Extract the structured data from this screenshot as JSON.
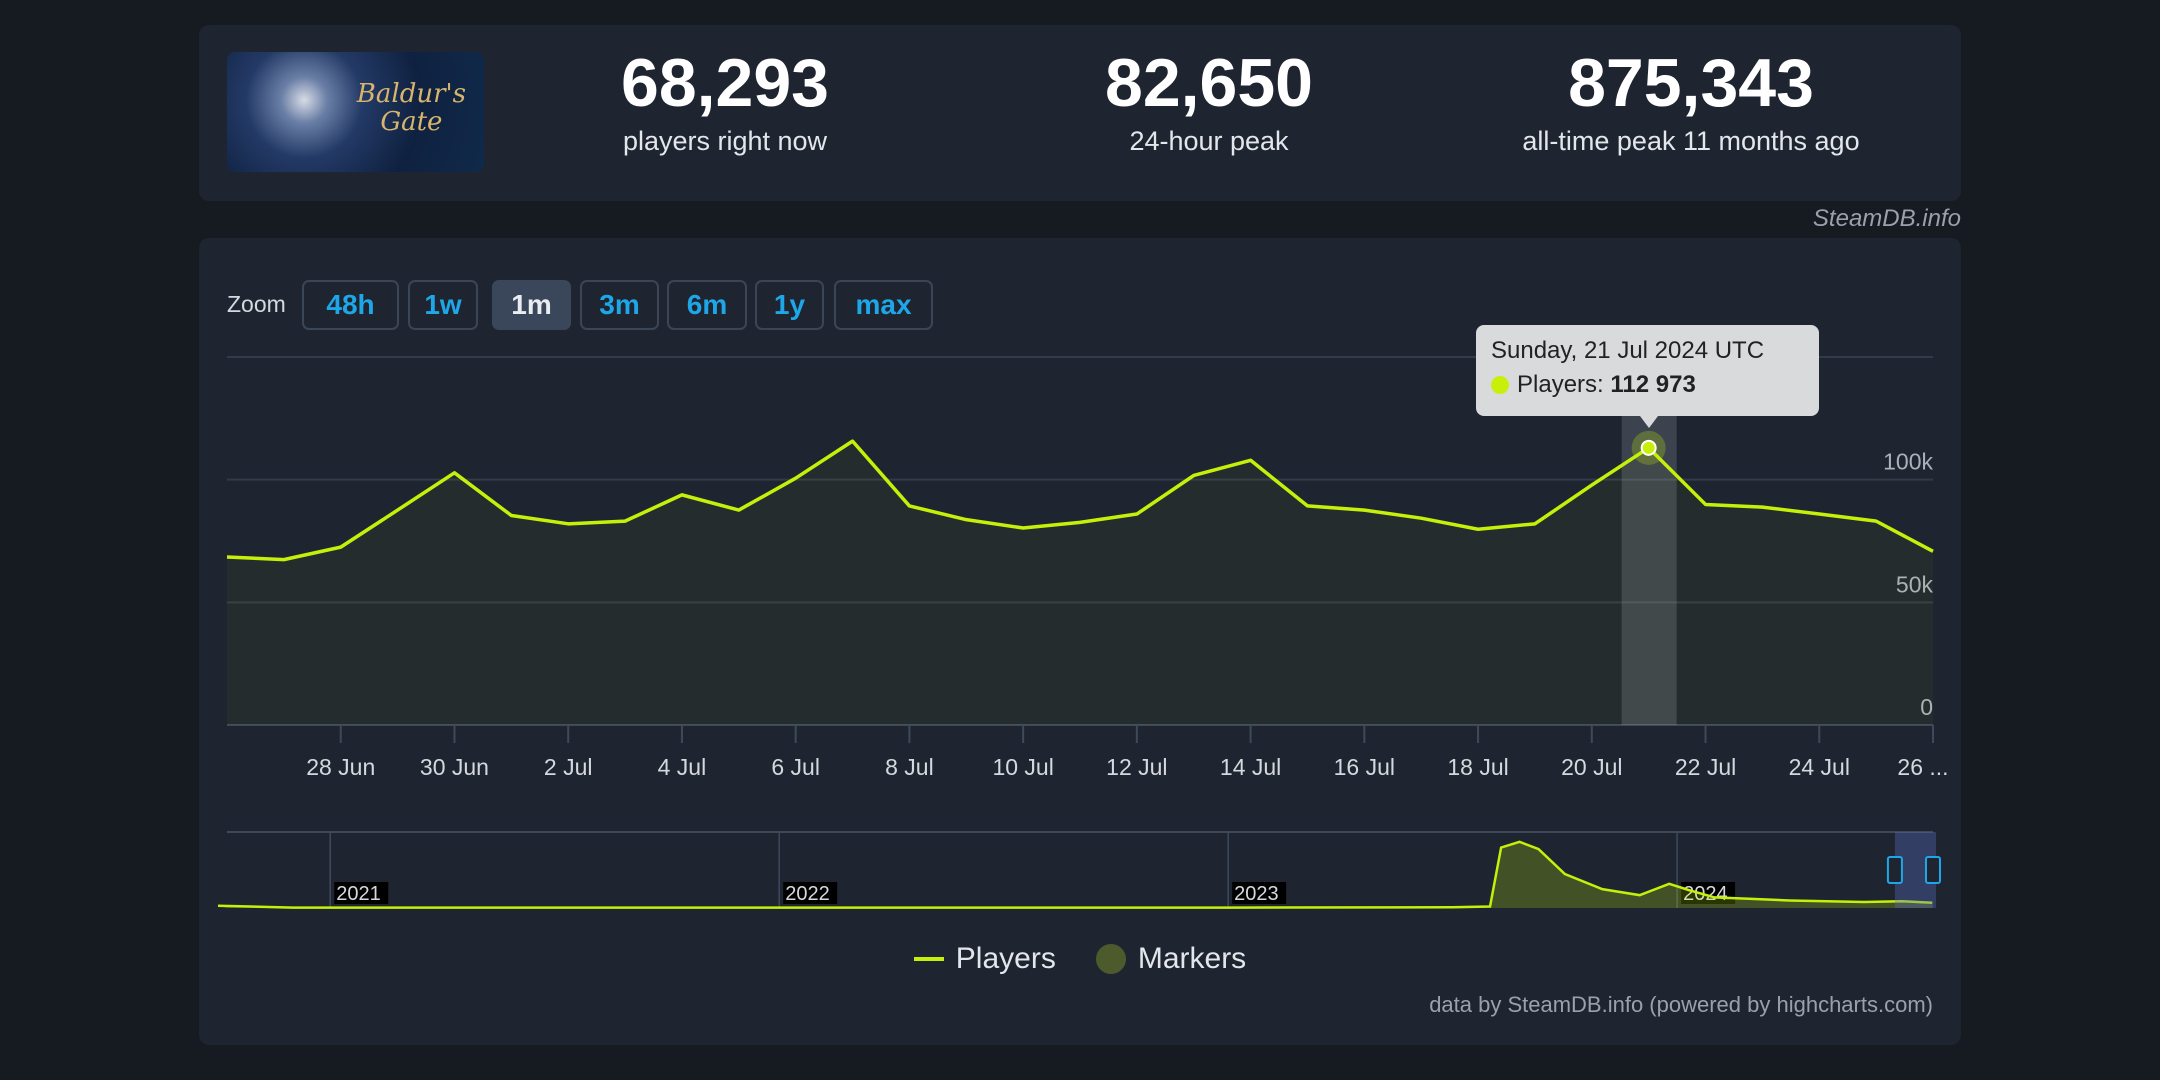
{
  "stats": {
    "image_caption": "Baldur's Gate",
    "current": {
      "value": "68,293",
      "label": "players right now"
    },
    "peak24": {
      "value": "82,650",
      "label": "24-hour peak"
    },
    "alltime": {
      "value": "875,343",
      "label": "all-time peak 11 months ago"
    }
  },
  "credit_top": "SteamDB.info",
  "zoom": {
    "label": "Zoom",
    "buttons": [
      "48h",
      "1w",
      "1m",
      "3m",
      "6m",
      "1y",
      "max"
    ],
    "active": "1m"
  },
  "tooltip": {
    "date": "Sunday, 21 Jul 2024 UTC",
    "series": "Players:",
    "value": "112 973"
  },
  "legend": {
    "players": "Players",
    "markers": "Markers"
  },
  "credit_bottom": "data by SteamDB.info (powered by highcharts.com)",
  "colors": {
    "line": "#c6f00a",
    "markers": "#4d5b2c",
    "accent": "#1ea7e8",
    "background": "#1f2530"
  },
  "chart_data": [
    {
      "type": "area",
      "series": [
        {
          "name": "Players",
          "start": "2024-06-26",
          "interval": "1 day",
          "values": [
            68500,
            67400,
            72500,
            87600,
            102800,
            85400,
            82000,
            83100,
            93800,
            87600,
            100600,
            115700,
            89300,
            83700,
            80300,
            82600,
            86000,
            101700,
            107900,
            89300,
            87600,
            84300,
            79800,
            82000,
            97800,
            112973,
            89900,
            88800,
            86000,
            83100,
            70800
          ]
        }
      ],
      "x_tick_labels": [
        "28 Jun",
        "30 Jun",
        "2 Jul",
        "4 Jul",
        "6 Jul",
        "8 Jul",
        "10 Jul",
        "12 Jul",
        "14 Jul",
        "16 Jul",
        "18 Jul",
        "20 Jul",
        "22 Jul",
        "24 Jul",
        "26 ..."
      ],
      "y_tick_labels": [
        "0",
        "50k",
        "100k"
      ],
      "ylim": [
        0,
        150000
      ],
      "grid": true,
      "highlighted_point": "2024-07-21",
      "legend": "bottom"
    },
    {
      "type": "area",
      "role": "navigator",
      "x_tick_labels": [
        "2021",
        "2022",
        "2023",
        "2024"
      ],
      "series": [
        {
          "name": "Players",
          "points": [
            [
              "2020-10",
              30000
            ],
            [
              "2020-12",
              5000
            ],
            [
              "2021-06",
              5000
            ],
            [
              "2022-01",
              5000
            ],
            [
              "2022-06",
              5000
            ],
            [
              "2023-01",
              5000
            ],
            [
              "2023-07",
              10000
            ],
            [
              "2023-08",
              20000
            ],
            [
              "2023-08-10",
              800000
            ],
            [
              "2023-08-25",
              875343
            ],
            [
              "2023-09-10",
              780000
            ],
            [
              "2023-10",
              450000
            ],
            [
              "2023-11",
              250000
            ],
            [
              "2023-12",
              170000
            ],
            [
              "2023-12-25",
              320000
            ],
            [
              "2024-01-10",
              240000
            ],
            [
              "2024-02",
              140000
            ],
            [
              "2024-03",
              120000
            ],
            [
              "2024-04",
              100000
            ],
            [
              "2024-05",
              90000
            ],
            [
              "2024-06",
              80000
            ],
            [
              "2024-07",
              90000
            ],
            [
              "2024-07-26",
              70000
            ]
          ]
        }
      ],
      "selected_range": [
        "2024-06-26",
        "2024-07-26"
      ]
    }
  ]
}
